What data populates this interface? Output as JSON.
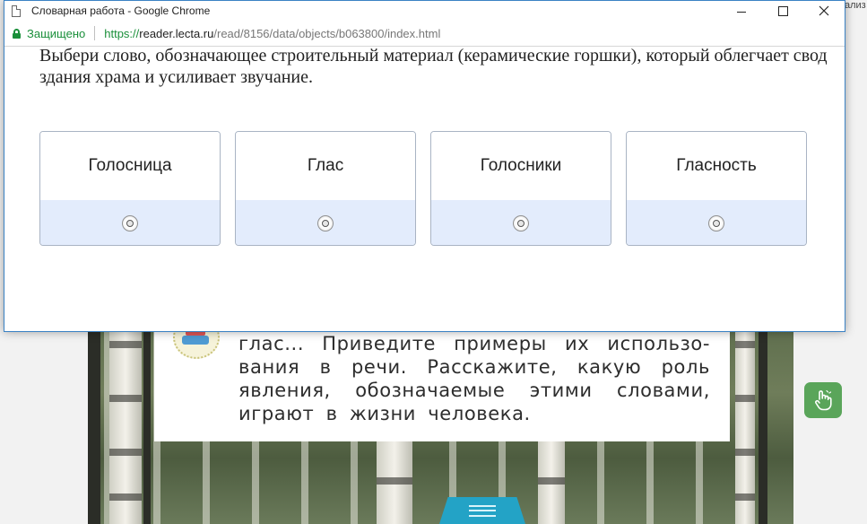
{
  "window": {
    "title": "Словарная работа - Google Chrome",
    "controls": {
      "minimize": "—",
      "maximize": "☐",
      "close": "✕"
    }
  },
  "addressbar": {
    "secure_label": "Защищено",
    "url_scheme": "https://",
    "url_host": "reader.lecta.ru",
    "url_path": "/read/8156/data/objects/b063800/index.html"
  },
  "quiz": {
    "question": "Выбери слово, обозначающее строительный материал (керамические горшки), который облегчает свод здания храма и усиливает звучание.",
    "options": [
      {
        "label": "Голосница",
        "selected": false
      },
      {
        "label": "Глас",
        "selected": false
      },
      {
        "label": "Голосники",
        "selected": false
      },
      {
        "label": "Гласность",
        "selected": false
      }
    ]
  },
  "background_page": {
    "side_text": "ализ",
    "book_lines": [
      "глас... Приведите примеры их использо-",
      "вания в речи. Расскажите, какую роль",
      "явления, обозначаемые этими словами,",
      "играют в жизни человека."
    ]
  },
  "icons": {
    "page": "page-icon",
    "lock": "lock-icon",
    "hand": "hand-pointer-icon",
    "menu": "menu-lines-icon"
  },
  "colors": {
    "secure_green": "#1a8f3a",
    "option_radio_bg": "#e3ecfc",
    "hand_button_bg": "#5aa55a",
    "bottom_tab_bg": "#23a3c6"
  }
}
